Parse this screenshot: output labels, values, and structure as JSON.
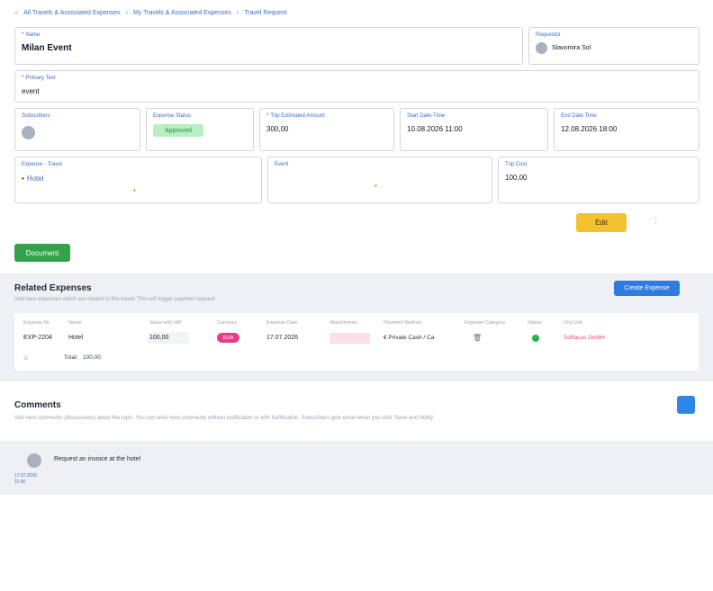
{
  "breadcrumb": {
    "home_icon": "home-icon",
    "items": [
      "All Travels & Associated Expenses",
      "My Travels & Associated Expenses",
      "Travel Request"
    ],
    "separator": "›"
  },
  "form": {
    "name": {
      "label": "Name",
      "value": "Milan Event",
      "required_mark": "*"
    },
    "requestor": {
      "label": "Requestor",
      "value": "Slavomira Sol"
    },
    "primary_text": {
      "label": "Primary Text",
      "value": "event",
      "required_mark": "*"
    },
    "subscribers": {
      "label": "Subscribers"
    },
    "expense_status": {
      "label": "Expense Status",
      "value": "Approved"
    },
    "trip_estimated_amount": {
      "label": "Trip Estimated Amount",
      "value": "300,00",
      "required_mark": "*"
    },
    "start_date": {
      "label": "Start Date-Time",
      "value": "10.08.2026 11:00"
    },
    "end_date": {
      "label": "End Date Time",
      "value": "12.08.2026 18:00"
    },
    "expense_travel": {
      "label": "Expense - Travel",
      "bullet": "•",
      "item": "Hotel",
      "add": "+"
    },
    "event": {
      "label": "Event",
      "add": "+"
    },
    "trip_cost": {
      "label": "Trip Cost",
      "value": "100,00"
    }
  },
  "actions": {
    "edit": "Edit",
    "more": "⋮",
    "document": "Document"
  },
  "related_expenses": {
    "title": "Related Expenses",
    "subtitle": "Add here expenses which are related to this travel. This will trigger payment request",
    "create_button": "Create Expense",
    "columns": [
      "Expense Nr.",
      "Name",
      "Value with VAT",
      "Currency",
      "Expense Date",
      "Attachments",
      "Payment Method",
      "Expense Category",
      "Status",
      "Org Unit"
    ],
    "rows": [
      {
        "expense_nr": "EXP-2204",
        "name": "Hotel",
        "value": "100,00",
        "currency": "EUR",
        "date": "17.07.2026",
        "payment_method": "€  Private Cash / Ca",
        "org_unit": "Softacus GmbH"
      }
    ],
    "total_label": "Total:",
    "total_value": "100,00",
    "status_color": "#27b34b"
  },
  "comments": {
    "title": "Comments",
    "subtitle": "Add here comments (discussions) about the topic. You can write here comments without notification or with Notification. Subscribers gets email when you click 'Save and Notify'",
    "items": [
      {
        "text": "Request an invoice at the hotel",
        "date": "17.07.2026",
        "time": "11:06"
      }
    ]
  }
}
